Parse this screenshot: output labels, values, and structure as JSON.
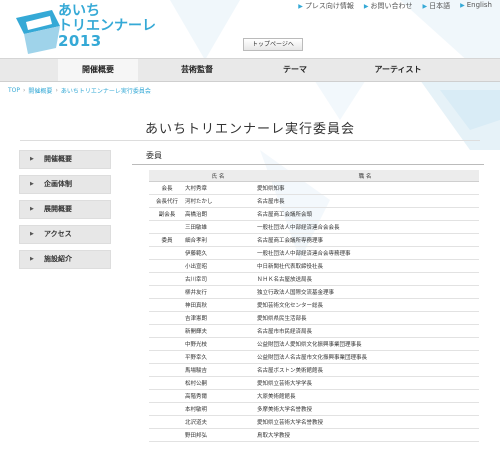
{
  "header": {
    "logo_line1": "あいち",
    "logo_line2": "トリエンナーレ",
    "logo_year": "2013",
    "top_links": [
      "プレス向け情報",
      "お問い合わせ",
      "日本語",
      "English"
    ],
    "top_page_button": "トップページへ"
  },
  "nav": [
    "開催概要",
    "芸術監督",
    "テーマ",
    "アーティスト"
  ],
  "breadcrumb": [
    "TOP",
    "開催概要",
    "あいちトリエンナーレ実行委員会"
  ],
  "page_title": "あいちトリエンナーレ実行委員会",
  "sidebar": [
    "開催概要",
    "企画体制",
    "展開概要",
    "アクセス",
    "施設紹介"
  ],
  "section_title": "委員",
  "table": {
    "headers": [
      "氏 名",
      "職 名"
    ],
    "rows": [
      {
        "role": "会長",
        "name": "大村秀章",
        "title": "愛知県知事"
      },
      {
        "role": "会長代行",
        "name": "河村たかし",
        "title": "名古屋市長"
      },
      {
        "role": "副会長",
        "name": "高橋治朗",
        "title": "名古屋商工会議所会頭"
      },
      {
        "role": "",
        "name": "三田敏雄",
        "title": "一般社団法人中部経済連合会会長"
      },
      {
        "role": "委員",
        "name": "細合孝利",
        "title": "名古屋商工会議所専務理事"
      },
      {
        "role": "",
        "name": "伊藤範久",
        "title": "一般社団法人中部経済連合会専務理事"
      },
      {
        "role": "",
        "name": "小出宣昭",
        "title": "中日新聞社代表取締役社長"
      },
      {
        "role": "",
        "name": "古川幸司",
        "title": "ＮＨＫ名古屋放送局長"
      },
      {
        "role": "",
        "name": "柳井友行",
        "title": "独立行政法人国際交流基金理事"
      },
      {
        "role": "",
        "name": "神田真秋",
        "title": "愛知芸術文化センター総長"
      },
      {
        "role": "",
        "name": "吉津憲朗",
        "title": "愛知県県民生活部長"
      },
      {
        "role": "",
        "name": "新開輝夫",
        "title": "名古屋市市民経済局長"
      },
      {
        "role": "",
        "name": "中野光枝",
        "title": "公益財団法人愛知県文化振興事業団理事長"
      },
      {
        "role": "",
        "name": "平野幸久",
        "title": "公益財団法人名古屋市文化振興事業団理事長"
      },
      {
        "role": "",
        "name": "馬場駿吉",
        "title": "名古屋ボストン美術館館長"
      },
      {
        "role": "",
        "name": "松村公嗣",
        "title": "愛知県立芸術大学学長"
      },
      {
        "role": "",
        "name": "高階秀爾",
        "title": "大原美術館館長"
      },
      {
        "role": "",
        "name": "本村敏明",
        "title": "多摩美術大学名誉教授"
      },
      {
        "role": "",
        "name": "北沢道夫",
        "title": "愛知県立芸術大学名誉教授"
      },
      {
        "role": "",
        "name": "野田邦弘",
        "title": "鳥取大学教授"
      }
    ]
  }
}
